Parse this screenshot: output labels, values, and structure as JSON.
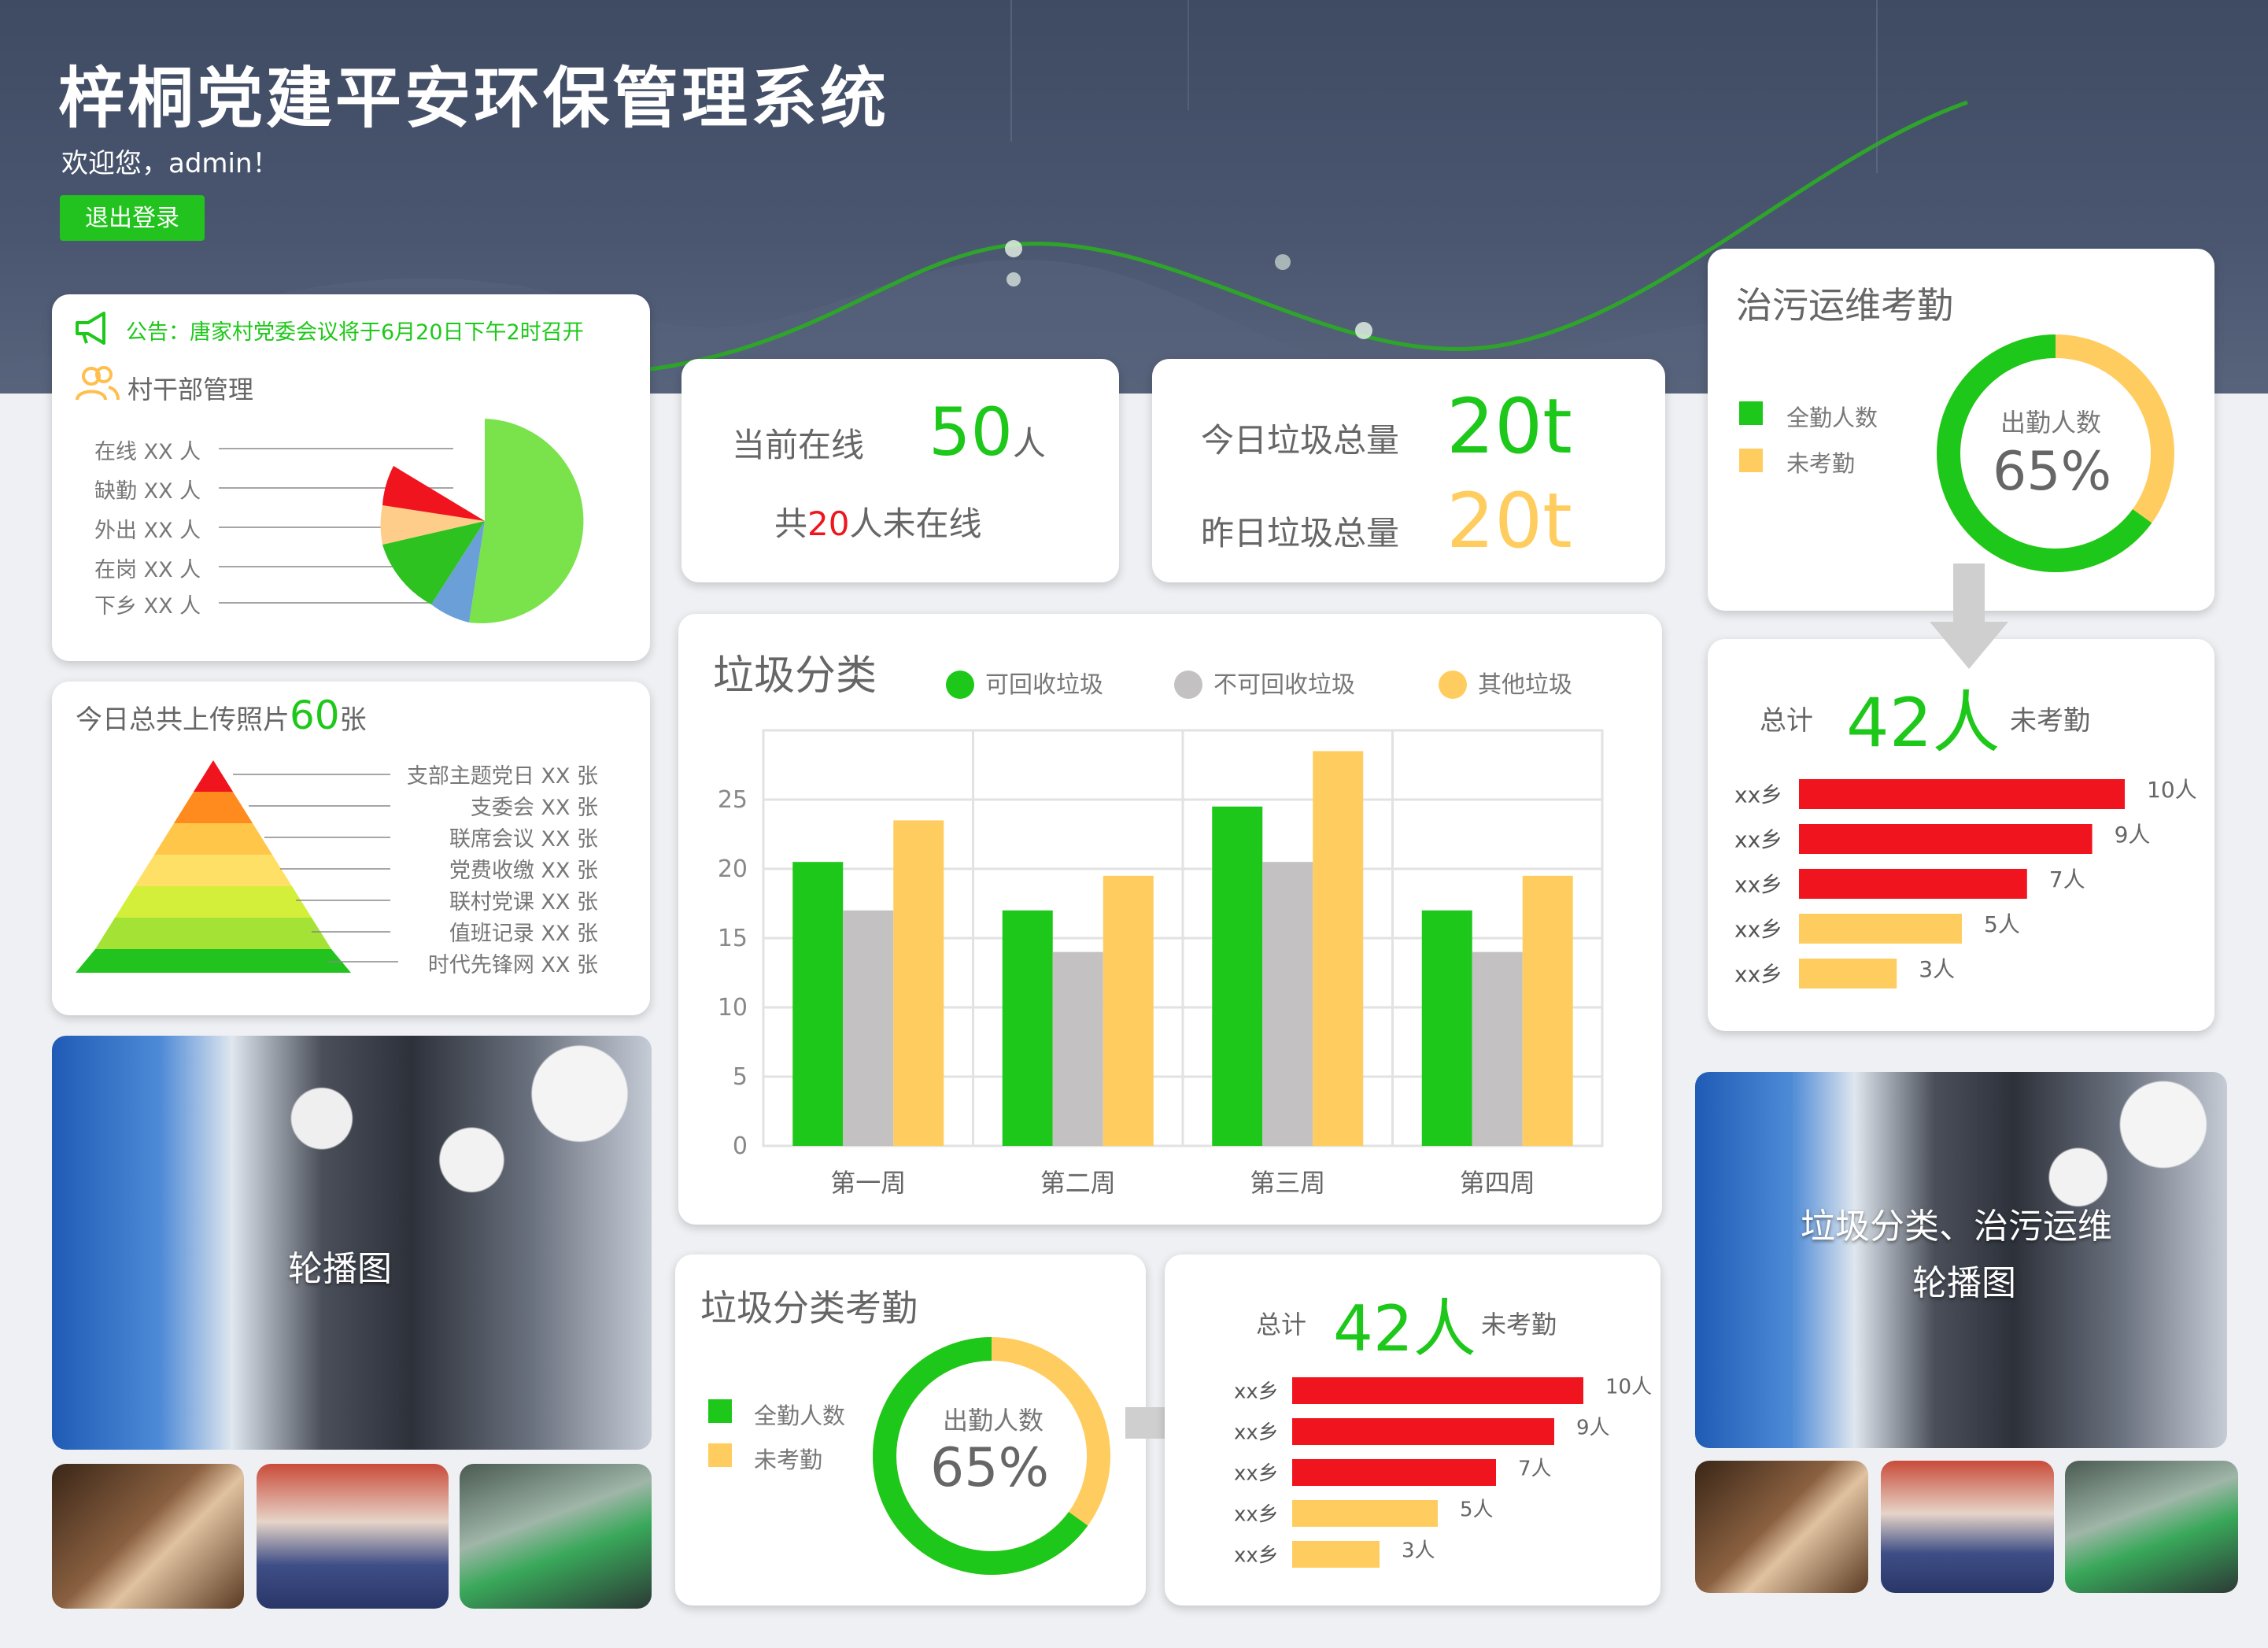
{
  "header": {
    "title": "梓桐党建平安环保管理系统",
    "welcome": "欢迎您，admin！",
    "logout": "退出登录"
  },
  "notice": {
    "text": "公告：唐家村党委会议将于6月20日下午2时召开"
  },
  "cadre": {
    "title": "村干部管理",
    "items": [
      "在线 XX 人",
      "缺勤 XX 人",
      "外出 XX 人",
      "在岗 XX 人",
      "下乡 XX 人"
    ]
  },
  "photos_today": {
    "prefix": "今日总共上传照片",
    "count": "60",
    "suffix": "张",
    "levels": [
      "支部主题党日 XX 张",
      "支委会 XX 张",
      "联席会议 XX 张",
      "党费收缴 XX 张",
      "联村党课 XX 张",
      "值班记录 XX 张",
      "时代先锋网 XX 张"
    ]
  },
  "online": {
    "label": "当前在线",
    "count": "50",
    "unit": "人",
    "offline_prefix": "共",
    "offline_count": "20",
    "offline_suffix": "人未在线"
  },
  "garbage_total": {
    "today_label": "今日垃圾总量",
    "today_value": "20t",
    "yesterday_label": "昨日垃圾总量",
    "yesterday_value": "20t"
  },
  "chart_data": {
    "type": "bar",
    "title": "垃圾分类",
    "categories": [
      "第一周",
      "第二周",
      "第三周",
      "第四周"
    ],
    "series": [
      {
        "name": "可回收垃圾",
        "color": "#1ec81a",
        "values": [
          20.5,
          17,
          24.5,
          17
        ]
      },
      {
        "name": "不可回收垃圾",
        "color": "#c4c1c2",
        "values": [
          17,
          14,
          20.5,
          14
        ]
      },
      {
        "name": "其他垃圾",
        "color": "#ffcd5f",
        "values": [
          23.5,
          19.5,
          28.5,
          19.5
        ]
      }
    ],
    "ylim": [
      0,
      30
    ],
    "yticks": [
      "0",
      "5",
      "10",
      "15",
      "20",
      "25"
    ],
    "grid": true,
    "legend": "top"
  },
  "pollution_attendance": {
    "title": "治污运维考勤",
    "legend": [
      "全勤人数",
      "未考勤"
    ],
    "center_label": "出勤人数",
    "center_value": "65%",
    "fraction": 0.65
  },
  "pollution_absent": {
    "prefix": "总计",
    "count": "42人",
    "suffix": "未考勤",
    "rows": [
      {
        "label": "xx乡",
        "value": "10人",
        "n": 10
      },
      {
        "label": "xx乡",
        "value": "9人",
        "n": 9
      },
      {
        "label": "xx乡",
        "value": "7人",
        "n": 7
      },
      {
        "label": "xx乡",
        "value": "5人",
        "n": 5
      },
      {
        "label": "xx乡",
        "value": "3人",
        "n": 3
      }
    ]
  },
  "garbage_attendance": {
    "title": "垃圾分类考勤",
    "legend": [
      "全勤人数",
      "未考勤"
    ],
    "center_label": "出勤人数",
    "center_value": "65%",
    "fraction": 0.65
  },
  "garbage_absent": {
    "prefix": "总计",
    "count": "42人",
    "suffix": "未考勤",
    "rows": [
      {
        "label": "xx乡",
        "value": "10人",
        "n": 10
      },
      {
        "label": "xx乡",
        "value": "9人",
        "n": 9
      },
      {
        "label": "xx乡",
        "value": "7人",
        "n": 7
      },
      {
        "label": "xx乡",
        "value": "5人",
        "n": 5
      },
      {
        "label": "xx乡",
        "value": "3人",
        "n": 3
      }
    ]
  },
  "carousel_left": {
    "caption": "轮播图"
  },
  "carousel_right": {
    "caption_line1": "垃圾分类、治污运维",
    "caption_line2": "轮播图"
  },
  "colors": {
    "green": "#1ec81a",
    "red": "#f0141e",
    "yellow": "#ffcd5f",
    "gray": "#c4c1c2",
    "header": "#46526a"
  }
}
